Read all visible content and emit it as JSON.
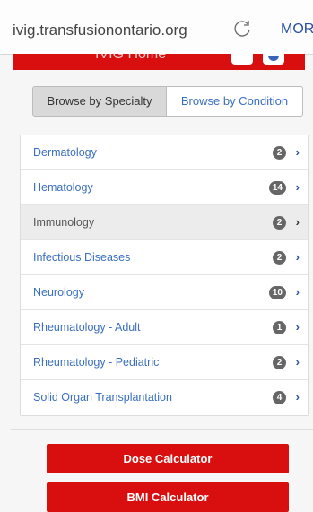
{
  "browser": {
    "url": "ivig.transfusionontario.org",
    "more_label": "MORE"
  },
  "header": {
    "title": "IVIG Home"
  },
  "tabs": {
    "specialty_label": "Browse by Specialty",
    "condition_label": "Browse by Condition",
    "active": "specialty"
  },
  "specialties": [
    {
      "label": "Dermatology",
      "count": "2"
    },
    {
      "label": "Hematology",
      "count": "14"
    },
    {
      "label": "Immunology",
      "count": "2"
    },
    {
      "label": "Infectious Diseases",
      "count": "2"
    },
    {
      "label": "Neurology",
      "count": "10"
    },
    {
      "label": "Rheumatology - Adult",
      "count": "1"
    },
    {
      "label": "Rheumatology - Pediatric",
      "count": "2"
    },
    {
      "label": "Solid Organ Transplantation",
      "count": "4"
    }
  ],
  "calculators": {
    "dose_label": "Dose Calculator",
    "bmi_label": "BMI Calculator"
  },
  "colors": {
    "brand_red": "#d90f0f",
    "link_blue": "#3a6fbf",
    "badge_gray": "#666666"
  },
  "icons": {
    "reload": "reload-icon",
    "chevron": "chevron-right-icon"
  }
}
